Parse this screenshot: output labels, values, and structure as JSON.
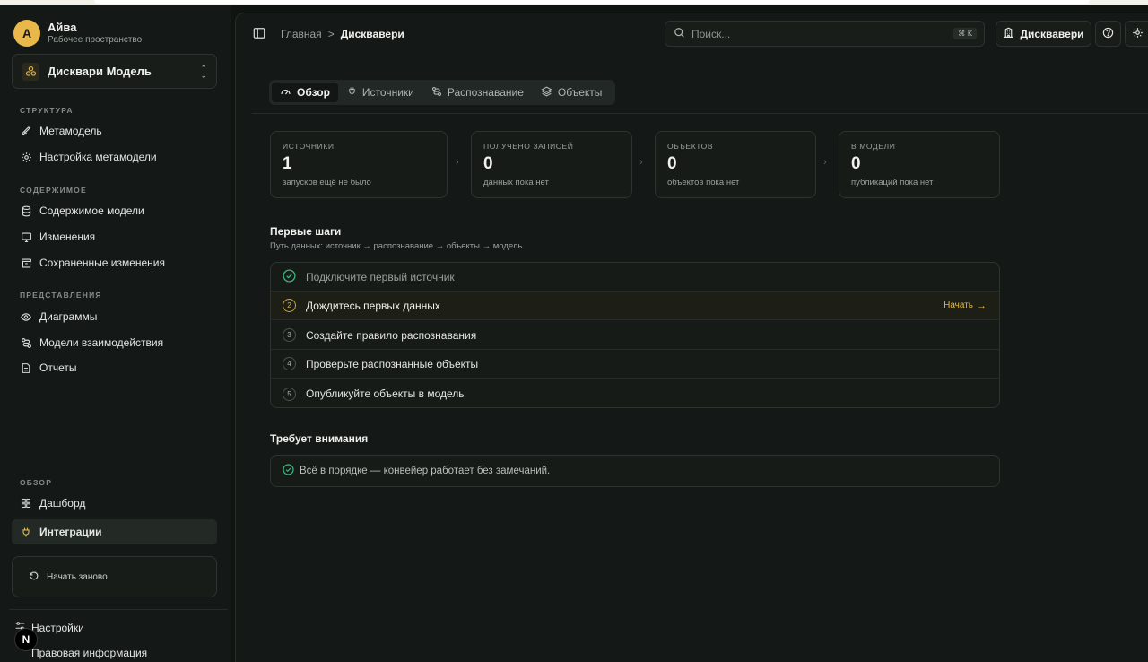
{
  "workspace": {
    "initial": "А",
    "name": "Айва",
    "subtitle": "Рабочее пространство"
  },
  "model_select": {
    "label": "Дисквари Модель"
  },
  "sidebar": {
    "sections": {
      "structure": "СТРУКТУРА",
      "content": "СОДЕРЖИМОЕ",
      "views": "ПРЕДСТАВЛЕНИЯ",
      "overview": "ОБЗОР"
    },
    "items": {
      "metamodel": "Метамодель",
      "metamodel_settings": "Настройка метамодели",
      "model_content": "Содержимое модели",
      "changes": "Изменения",
      "saved_changes": "Сохраненные изменения",
      "diagrams": "Диаграммы",
      "interaction_models": "Модели взаимодействия",
      "reports": "Отчеты",
      "dashboard": "Дашборд",
      "integrations": "Интеграции"
    },
    "restart_label": "Начать заново",
    "settings_label": "Настройки",
    "legal_label": "Правовая информация",
    "badge": "N"
  },
  "header": {
    "breadcrumb_home": "Главная",
    "breadcrumb_sep": ">",
    "breadcrumb_current": "Дисквавери",
    "search_placeholder": "Поиск...",
    "search_shortcut": "⌘ K",
    "discovery_button": "Дисквавери"
  },
  "tabs": [
    "Обзор",
    "Источники",
    "Распознавание",
    "Объекты"
  ],
  "stats": [
    {
      "title": "ИСТОЧНИКИ",
      "value": "1",
      "sub": "запусков ещё не было"
    },
    {
      "title": "ПОЛУЧЕНО ЗАПИСЕЙ",
      "value": "0",
      "sub": "данных пока нет"
    },
    {
      "title": "ОБЪЕКТОВ",
      "value": "0",
      "sub": "объектов пока нет"
    },
    {
      "title": "В МОДЕЛИ",
      "value": "0",
      "sub": "публикаций пока нет"
    }
  ],
  "first_steps": {
    "title": "Первые шаги",
    "subtitle": "Путь данных: источник → распознавание → объекты → модель",
    "steps": [
      {
        "num": "",
        "label": "Подключите первый источник",
        "status": "done"
      },
      {
        "num": "2",
        "label": "Дождитесь первых данных",
        "status": "current"
      },
      {
        "num": "3",
        "label": "Создайте правило распознавания",
        "status": "todo"
      },
      {
        "num": "4",
        "label": "Проверьте распознанные объекты",
        "status": "todo"
      },
      {
        "num": "5",
        "label": "Опубликуйте объекты в модель",
        "status": "todo"
      }
    ],
    "start_label": "Начать",
    "start_arrow": "→"
  },
  "attention": {
    "title": "Требует внимания",
    "message": "Всё в порядке — конвейер работает без замечаний."
  },
  "colors": {
    "accent": "#e4b847",
    "success": "#3fb37f",
    "background": "#141917"
  }
}
